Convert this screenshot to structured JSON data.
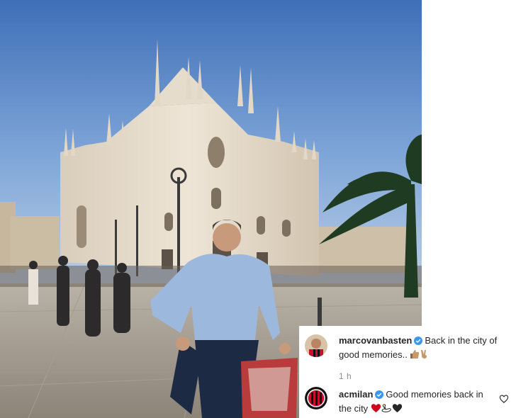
{
  "post": {
    "image_icon": "milan-cathedral-photo"
  },
  "comments": [
    {
      "username": "marcovanbasten",
      "verified": true,
      "text": "Back in the city of good memories..",
      "emojis": [
        "thumbs-up-icon",
        "victory-hand-icon"
      ]
    },
    {
      "username": "acmilan",
      "verified": true,
      "text": "Good memories back in the city",
      "emojis": [
        "red-heart-icon",
        "swan-icon",
        "black-heart-icon"
      ]
    }
  ],
  "timestamp": "1 h",
  "colors": {
    "verified": "#3897f0",
    "text": "#262626",
    "muted": "#8e8e8e",
    "acmilan_red": "#c8102e"
  }
}
